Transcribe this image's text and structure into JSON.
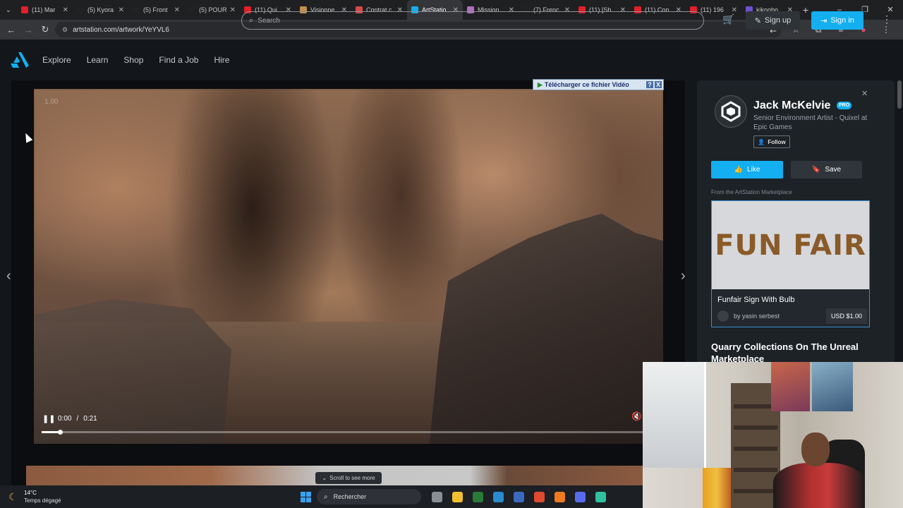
{
  "browser": {
    "tabs": [
      {
        "label": "(11) Mar",
        "fav_color": "#e0202a"
      },
      {
        "label": "(5) Kyora",
        "fav_color": "#222222"
      },
      {
        "label": "(5) Front",
        "fav_color": "#222222"
      },
      {
        "label": "(5) POUR",
        "fav_color": "#222222"
      },
      {
        "label": "(11) Qui",
        "fav_color": "#e0202a"
      },
      {
        "label": "Visionne",
        "fav_color": "#c09050"
      },
      {
        "label": "Contrat c",
        "fav_color": "#d84848"
      },
      {
        "label": "ArtStatio",
        "fav_color": "#13aff0",
        "active": true
      },
      {
        "label": "Mission",
        "fav_color": "#b070c0"
      },
      {
        "label": "(7) Frenc",
        "fav_color": "#222222"
      },
      {
        "label": "(11) [Sh",
        "fav_color": "#e0202a"
      },
      {
        "label": "(11) Con",
        "fav_color": "#e0202a"
      },
      {
        "label": "(11) 196",
        "fav_color": "#e0202a"
      },
      {
        "label": "kikoobo",
        "fav_color": "#7050d0"
      }
    ],
    "url": "artstation.com/artwork/YeYVL6"
  },
  "header": {
    "nav": [
      "Explore",
      "Learn",
      "Shop",
      "Find a Job",
      "Hire"
    ],
    "search_placeholder": "Search",
    "signup_label": "Sign up",
    "signin_label": "Sign in"
  },
  "video": {
    "speed": "1.00",
    "current_time": "0:00",
    "duration": "0:21",
    "progress_fraction": 0.03,
    "download_banner": "Télécharger ce fichier Vidéo",
    "download_help": "?",
    "download_close": "X",
    "scroll_hint": "Scroll to see more"
  },
  "artist": {
    "name": "Jack McKelvie",
    "badge": "PRO",
    "role": "Senior Environment Artist - Quixel at Epic Games",
    "follow_label": "Follow",
    "like_label": "Like",
    "save_label": "Save"
  },
  "marketplace": {
    "label": "From the ArtStation Marketplace",
    "image_text": "FUN FAIR",
    "title": "Funfair Sign With Bulb",
    "seller": "by yasin serbest",
    "price": "USD $1.00"
  },
  "section_heading": "Quarry Collections On The Unreal Marketplace",
  "taskbar": {
    "temperature": "14°C",
    "weather": "Temps dégagé",
    "search_label": "Rechercher",
    "apps": [
      "#8a8f96",
      "#f0c030",
      "#2a7a3a",
      "#2a8ad0",
      "#3a6ac0",
      "#e04a30",
      "#f07a20",
      "#5a6af0",
      "#30c0a0"
    ]
  },
  "colors": {
    "accent": "#13aff0",
    "background": "#13171c",
    "panel": "#1d2227"
  }
}
